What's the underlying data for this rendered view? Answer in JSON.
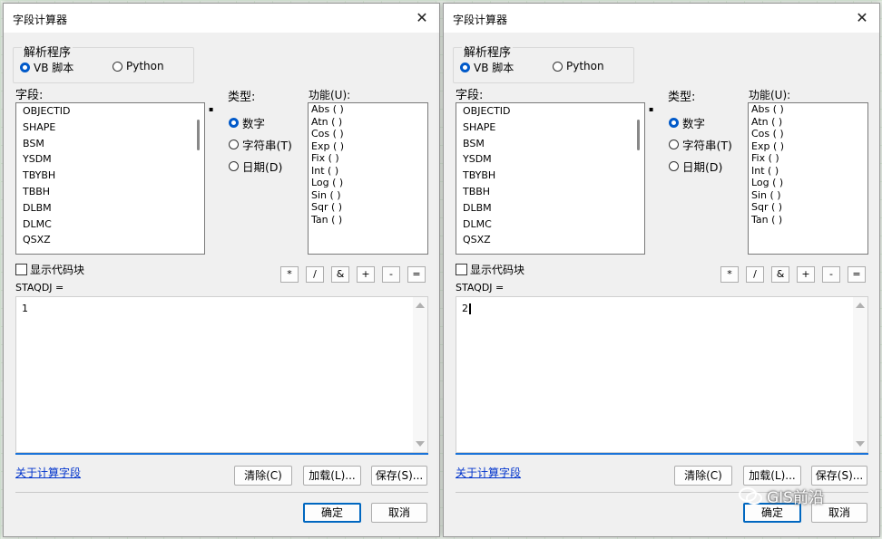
{
  "dialogs": [
    {
      "title": "字段计算器",
      "parser_legend": "解析程序",
      "parser_options": [
        "VB 脚本",
        "Python"
      ],
      "fields_label": "字段:",
      "fields": [
        "OBJECTID",
        "SHAPE",
        "BSM",
        "YSDM",
        "TBYBH",
        "TBBH",
        "DLBM",
        "DLMC",
        "QSXZ"
      ],
      "type_label": "类型:",
      "types": [
        "数字",
        "字符串(T)",
        "日期(D)"
      ],
      "functions_label": "功能(U):",
      "functions": [
        "Abs ( )",
        "Atn ( )",
        "Cos ( )",
        "Exp ( )",
        "Fix ( )",
        "Int ( )",
        "Log ( )",
        "Sin ( )",
        "Sqr ( )",
        "Tan ( )"
      ],
      "show_codeblock": "显示代码块",
      "operators": [
        "*",
        "/",
        "&",
        "+",
        "-",
        "="
      ],
      "expression_label": "STAQDJ =",
      "expression_value": "1",
      "about_link": "关于计算字段",
      "clear_btn": "清除(C)",
      "load_btn": "加载(L)...",
      "save_btn": "保存(S)...",
      "ok_btn": "确定",
      "cancel_btn": "取消"
    },
    {
      "title": "字段计算器",
      "parser_legend": "解析程序",
      "parser_options": [
        "VB 脚本",
        "Python"
      ],
      "fields_label": "字段:",
      "fields": [
        "OBJECTID",
        "SHAPE",
        "BSM",
        "YSDM",
        "TBYBH",
        "TBBH",
        "DLBM",
        "DLMC",
        "QSXZ"
      ],
      "type_label": "类型:",
      "types": [
        "数字",
        "字符串(T)",
        "日期(D)"
      ],
      "functions_label": "功能(U):",
      "functions": [
        "Abs ( )",
        "Atn ( )",
        "Cos ( )",
        "Exp ( )",
        "Fix ( )",
        "Int ( )",
        "Log ( )",
        "Sin ( )",
        "Sqr ( )",
        "Tan ( )"
      ],
      "show_codeblock": "显示代码块",
      "operators": [
        "*",
        "/",
        "&",
        "+",
        "-",
        "="
      ],
      "expression_label": "STAQDJ =",
      "expression_value": "2",
      "about_link": "关于计算字段",
      "clear_btn": "清除(C)",
      "load_btn": "加载(L)...",
      "save_btn": "保存(S)...",
      "ok_btn": "确定",
      "cancel_btn": "取消"
    }
  ],
  "watermark": "GIS前沿",
  "colors": {
    "accent": "#0059c9",
    "link": "#0033cc",
    "underline": "#1a73d9"
  }
}
